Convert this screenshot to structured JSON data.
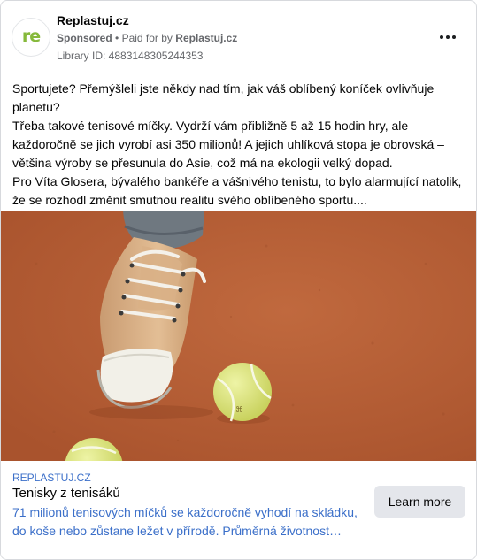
{
  "advertiser": {
    "name": "Replastuj.cz",
    "avatar_text": "re",
    "sponsored_label": "Sponsored",
    "separator": "•",
    "paid_for_prefix": "Paid for by",
    "paid_for_by": "Replastuj.cz",
    "library_id": "Library ID: 4883148305244353"
  },
  "menu": {
    "icon": "more-horizontal-icon"
  },
  "body_paragraphs": [
    "Sportujete? Přemýšleli jste někdy nad tím, jak váš oblíbený koníček ovlivňuje planetu?",
    "Třeba takové tenisové míčky. Vydrží vám přibližně 5 až 15 hodin hry, ale každoročně se jich vyrobí asi 350 milionů! A jejich uhlíková stopa je obrovská – většina výroby se přesunula do Asie, což má na ekologii velký dopad.",
    "Pro Víta Glosera, bývalého bankéře a vášnivého tenistu, to bylo alarmující natolik, že se rozhodl změnit smutnou realitu svého oblíbeného sportu...."
  ],
  "link_preview": {
    "domain": "REPLASTUJ.CZ",
    "title": "Tenisky z tenisáků",
    "description": "71 milionů tenisových míčků se každoročně vyhodí na skládku, do koše nebo zůstane ležet v přírodě. Průměrná životnost…",
    "cta_label": "Learn more"
  },
  "colors": {
    "link_blue": "#3b6fc9",
    "court_clay": "#b8633a",
    "logo_green": "#86b93b",
    "ball_yellow": "#dfe88a"
  }
}
